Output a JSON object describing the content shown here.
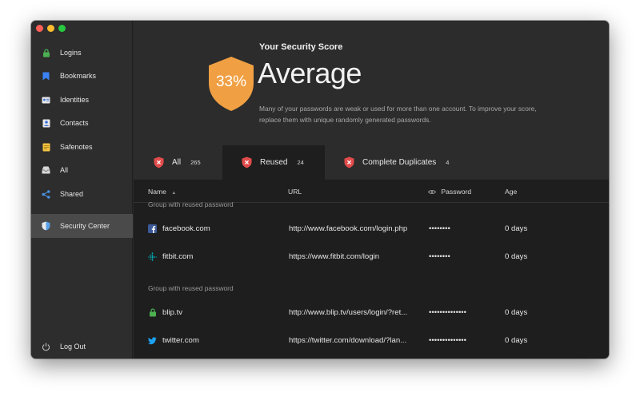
{
  "sidebar": {
    "items": [
      {
        "label": "Logins",
        "icon": "lock-icon"
      },
      {
        "label": "Bookmarks",
        "icon": "bookmark-icon"
      },
      {
        "label": "Identities",
        "icon": "id-card-icon"
      },
      {
        "label": "Contacts",
        "icon": "contact-icon"
      },
      {
        "label": "Safenotes",
        "icon": "note-icon"
      },
      {
        "label": "All",
        "icon": "inbox-icon"
      },
      {
        "label": "Shared",
        "icon": "share-icon"
      },
      {
        "label": "Security Center",
        "icon": "security-shield-icon"
      },
      {
        "label": "Log Out",
        "icon": "power-icon"
      }
    ]
  },
  "header": {
    "title": "Your Security Score",
    "score": "33%",
    "rating": "Average",
    "description": "Many of your passwords are weak or used for more than one account. To improve your score, replace them with unique randomly generated passwords."
  },
  "tabs": [
    {
      "label": "All",
      "count": "265"
    },
    {
      "label": "Reused",
      "count": "24"
    },
    {
      "label": "Complete Duplicates",
      "count": "4"
    }
  ],
  "table": {
    "columns": {
      "name": "Name",
      "url": "URL",
      "password": "Password",
      "age": "Age"
    },
    "groups": [
      {
        "label": "Group with reused password",
        "rows": [
          {
            "name": "facebook.com",
            "url": "http://www.facebook.com/login.php",
            "password": "••••••••",
            "age": "0 days",
            "icon": "facebook-icon"
          },
          {
            "name": "fitbit.com",
            "url": "https://www.fitbit.com/login",
            "password": "••••••••",
            "age": "0 days",
            "icon": "fitbit-icon"
          }
        ]
      },
      {
        "label": "Group with reused password",
        "rows": [
          {
            "name": "blip.tv",
            "url": "http://www.blip.tv/users/login/?ret...",
            "password": "••••••••••••••",
            "age": "0 days",
            "icon": "lock-icon"
          },
          {
            "name": "twitter.com",
            "url": "https://twitter.com/download/?lan...",
            "password": "••••••••••••••",
            "age": "0 days",
            "icon": "twitter-icon"
          }
        ]
      }
    ]
  },
  "colors": {
    "accent_orange": "#f0a043",
    "alert_red": "#e24b4b",
    "sidebar_bg": "#2d2d2d",
    "table_bg": "#1e1e1e"
  }
}
